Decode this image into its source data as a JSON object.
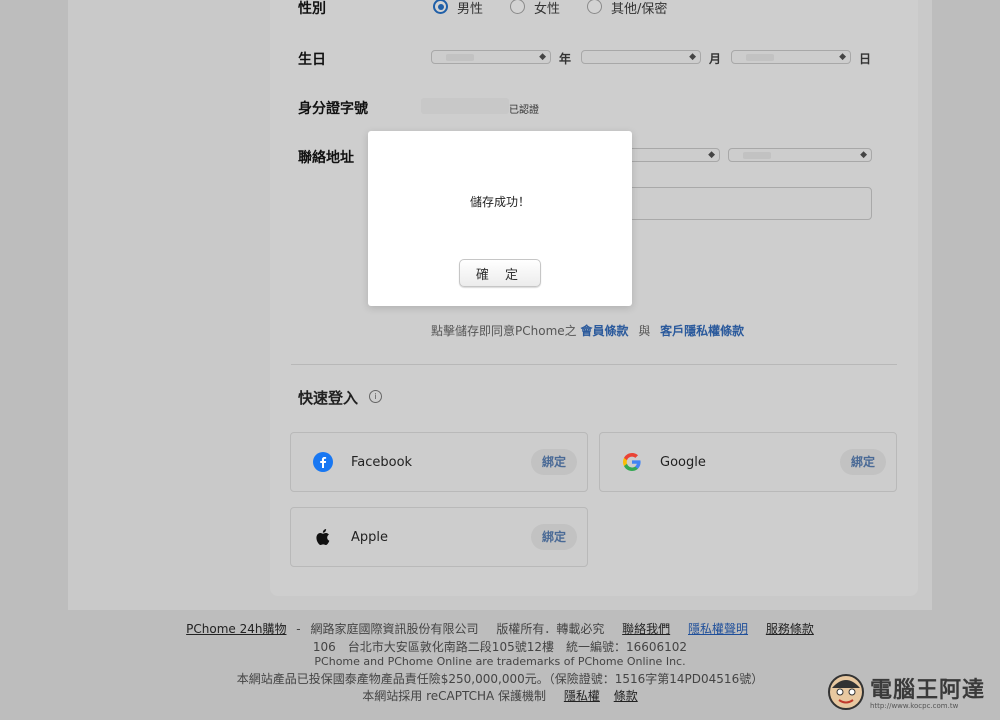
{
  "form": {
    "gender": {
      "label": "性別",
      "options": [
        {
          "label": "男性",
          "selected": true
        },
        {
          "label": "女性",
          "selected": false
        },
        {
          "label": "其他/保密",
          "selected": false
        }
      ]
    },
    "birthday": {
      "label": "生日",
      "year_unit": "年",
      "month_unit": "月",
      "day_unit": "日"
    },
    "id_number": {
      "label": "身分證字號",
      "status": "已認證"
    },
    "address": {
      "label": "聯絡地址"
    },
    "terms": {
      "prefix": "點擊儲存即同意PChome之",
      "member_terms": "會員條款",
      "and": "與",
      "privacy_terms": "客戶隱私權條款"
    }
  },
  "quick_login": {
    "title": "快速登入",
    "info_icon": "info-circle-icon",
    "bind_label": "綁定",
    "providers": [
      {
        "name": "Facebook",
        "icon": "facebook-icon"
      },
      {
        "name": "Google",
        "icon": "google-icon"
      },
      {
        "name": "Apple",
        "icon": "apple-icon"
      }
    ]
  },
  "footer": {
    "site_link": "PChome 24h購物",
    "dash": "-",
    "company": "網路家庭國際資訊股份有限公司",
    "rights": "版權所有．轉載必究",
    "contact": "聯絡我們",
    "privacy": "隱私權聲明",
    "service_terms": "服務條款",
    "address": "106　台北市大安區敦化南路二段105號12樓　統一編號：16606102",
    "trademark": "PChome and PChome Online are trademarks of PChome Online Inc.",
    "insurance": "本網站產品已投保國泰產物產品責任險$250,000,000元。（保險證號：1516字第14PD04516號）",
    "recaptcha": "本網站採用 reCAPTCHA 保護機制",
    "recaptcha_privacy": "隱私權",
    "recaptcha_terms": "條款"
  },
  "modal": {
    "message": "儲存成功！",
    "ok_label": "確 定"
  },
  "watermark": {
    "text": "電腦王阿達",
    "url": "http://www.kocpc.com.tw"
  },
  "colors": {
    "accent": "#1f5fa8",
    "link": "#2b5a9c",
    "facebook": "#1877f2"
  }
}
